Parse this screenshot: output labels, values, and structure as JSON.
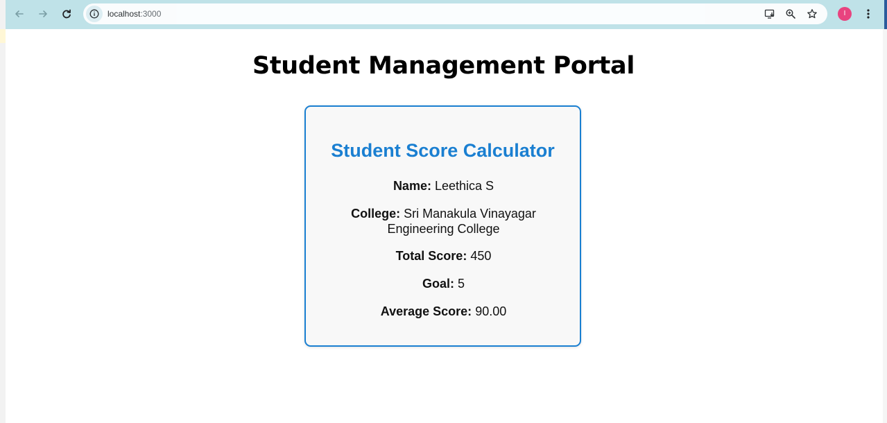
{
  "browser": {
    "url_host": "localhost",
    "url_port": ":3000",
    "profile_initial": "I",
    "accent_toolbar": "#bfe2e8",
    "profile_color": "#e8437f"
  },
  "page": {
    "title": "Student Management Portal"
  },
  "card": {
    "title": "Student Score Calculator",
    "accent": "#1a7fd1",
    "fields": [
      {
        "label": "Name:",
        "value": "Leethica S"
      },
      {
        "label": "College:",
        "value": "Sri Manakula Vinayagar Engineering College"
      },
      {
        "label": "Total Score:",
        "value": "450"
      },
      {
        "label": "Goal:",
        "value": "5"
      },
      {
        "label": "Average Score:",
        "value": "90.00"
      }
    ]
  },
  "icons": {
    "back": "back-arrow-icon",
    "forward": "forward-arrow-icon",
    "reload": "reload-icon",
    "site_info": "info-icon",
    "install": "install-app-icon",
    "zoom": "zoom-icon",
    "bookmark": "star-icon",
    "menu": "kebab-menu-icon"
  }
}
